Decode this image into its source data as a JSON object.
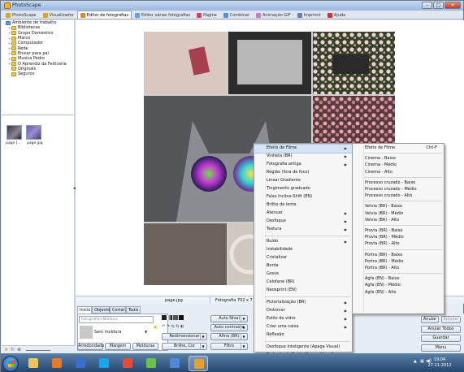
{
  "window": {
    "title": "PhotoScape"
  },
  "tabs": [
    {
      "label": "PhotoScape",
      "color": "#d9a431",
      "active": false
    },
    {
      "label": "Visualizador",
      "color": "#e2a02a",
      "active": false
    },
    {
      "label": "Editor de fotografias",
      "color": "#e28a2a",
      "active": true
    },
    {
      "label": "Editor várias fotografias",
      "color": "#6aa0d6",
      "active": false
    },
    {
      "label": "Página",
      "color": "#d6445a",
      "active": false
    },
    {
      "label": "Combinar",
      "color": "#5a8dd6",
      "active": false
    },
    {
      "label": "Animação GIF",
      "color": "#c77cc9",
      "active": false
    },
    {
      "label": "Imprimir",
      "color": "#6d7fa8",
      "active": false
    },
    {
      "label": "Ajuda",
      "color": "#d63434",
      "active": false
    }
  ],
  "tree": [
    {
      "label": "Ambiente de trabalho",
      "depth": 0,
      "expander": "-"
    },
    {
      "label": "Bibliotecas",
      "depth": 1,
      "expander": "+"
    },
    {
      "label": "Grupo Doméstico",
      "depth": 1,
      "expander": "+"
    },
    {
      "label": "Marco",
      "depth": 1,
      "expander": "+"
    },
    {
      "label": "Computador",
      "depth": 1,
      "expander": "+"
    },
    {
      "label": "Rede",
      "depth": 1,
      "expander": "+"
    },
    {
      "label": "Enviar para pai",
      "depth": 1,
      "expander": "+"
    },
    {
      "label": "Musica Pedro",
      "depth": 1,
      "expander": "+"
    },
    {
      "label": "O Aprendiz  da Feiticeira",
      "depth": 1,
      "expander": "+"
    },
    {
      "label": "Originals",
      "depth": 1,
      "expander": ""
    },
    {
      "label": "Seguros",
      "depth": 1,
      "expander": ""
    }
  ],
  "thumbnails": [
    {
      "caption": "page [...",
      "color": "#5d5560"
    },
    {
      "caption": "page.jpg",
      "color": "#6b5aa8"
    }
  ],
  "status": {
    "filename": "page.jpg",
    "info": "Fotografia 702 x 7"
  },
  "panel": {
    "tabs": [
      "Início",
      "Objecto",
      "Cortar",
      "Tools"
    ],
    "frame_dropdown": "Fotografia+Moldura",
    "frame_name": "Sem moldura",
    "buttons": {
      "auto_level": "Auto Nível",
      "auto_contrast": "Auto contraste",
      "resize": "Redimensionar",
      "sharpen": "Afina (BR)",
      "brightness": "Brilho, Cor",
      "filter": "Filtro",
      "rounded": "Arredondado",
      "margin": "Margem",
      "frames": "Molduras"
    }
  },
  "right_buttons": {
    "undo": "Anular",
    "redo": "Refazer",
    "undo_all": "Anular Todos",
    "save": "Guardar",
    "menu": "Menu"
  },
  "filter_menu": [
    {
      "label": "Efeito de Filme",
      "sub": true,
      "highlight": true
    },
    {
      "label": "Vinheta (BR)",
      "sub": true
    },
    {
      "label": "Fotografia antiga",
      "sub": true
    },
    {
      "label": "Região (fora de foco)",
      "sub": false
    },
    {
      "label": "Linear Gradiente",
      "sub": false
    },
    {
      "label": "Tingimento graduado",
      "sub": false
    },
    {
      "label": "Falso Incline-Shift (EN)",
      "sub": false
    },
    {
      "label": "Brilho de lente",
      "sub": false
    },
    {
      "label": "Atenuar",
      "sub": true
    },
    {
      "label": "Desfoque",
      "sub": true
    },
    {
      "label": "Textura",
      "sub": true
    },
    {
      "sep": true
    },
    {
      "label": "Ruído",
      "sub": true
    },
    {
      "label": "Instabilidade",
      "sub": false
    },
    {
      "label": "Cristalizar",
      "sub": false
    },
    {
      "label": "Borda",
      "sub": false
    },
    {
      "label": "Grave",
      "sub": false
    },
    {
      "label": "Celofane (BR)",
      "sub": false
    },
    {
      "label": "Neoxprint (EN)",
      "sub": false
    },
    {
      "sep": true
    },
    {
      "label": "Pictorialização (BR)",
      "sub": true
    },
    {
      "label": "Distorcer",
      "sub": true
    },
    {
      "label": "Estilo de vidro",
      "sub": true
    },
    {
      "label": "Criar uma caixa",
      "sub": true
    },
    {
      "label": "Reflexão",
      "sub": false
    },
    {
      "sep": true
    },
    {
      "label": "Desfoque Inteligente (Apaga Visual)",
      "sub": false
    },
    {
      "label": "Redução de Ruído (Apaga Visual)",
      "sub": true
    }
  ],
  "film_menu": [
    {
      "label": "Efeito de Filme",
      "shortcut": "Ctrl-F"
    },
    {
      "sep": true
    },
    {
      "label": "Cinema - Baixo"
    },
    {
      "label": "Cinema - Médio"
    },
    {
      "label": "Cinema - Alto"
    },
    {
      "sep": true
    },
    {
      "label": "Processo cruzado - Baixo"
    },
    {
      "label": "Processo cruzado - Médio"
    },
    {
      "label": "Processo cruzado - Alto"
    },
    {
      "sep": true
    },
    {
      "label": "Velvia (BR) - Baixo"
    },
    {
      "label": "Velvia (BR) - Médio"
    },
    {
      "label": "Velvia (BR) - Alto"
    },
    {
      "sep": true
    },
    {
      "label": "Provia (BR) - Baixo"
    },
    {
      "label": "Provia (BR) - Médio"
    },
    {
      "label": "Provia (BR) - Alto"
    },
    {
      "sep": true
    },
    {
      "label": "Portra (BR) - Baixo"
    },
    {
      "label": "Portra (BR) - Médio"
    },
    {
      "label": "Portra (BR) - Alto"
    },
    {
      "sep": true
    },
    {
      "label": "Agfa (EN) - Baixo"
    },
    {
      "label": "Agfa (EN) - Médio"
    },
    {
      "label": "Agfa (EN) - Alto"
    }
  ],
  "taskbar": {
    "apps": [
      {
        "name": "explorer-icon",
        "color": "#e9c75d"
      },
      {
        "name": "media-player-icon",
        "color": "#e8782b"
      },
      {
        "name": "movie-maker-icon",
        "color": "#3a6ed0"
      },
      {
        "name": "skype-icon",
        "color": "#1aa3e8"
      },
      {
        "name": "chrome-icon",
        "color": "#e34b3b"
      },
      {
        "name": "messenger-icon",
        "color": "#6bc24a"
      },
      {
        "name": "browser-icon",
        "color": "#4e88d8"
      },
      {
        "name": "photoscape-icon",
        "color": "#e6a02e"
      }
    ],
    "time": "19:04",
    "date": "27-11-2012"
  }
}
